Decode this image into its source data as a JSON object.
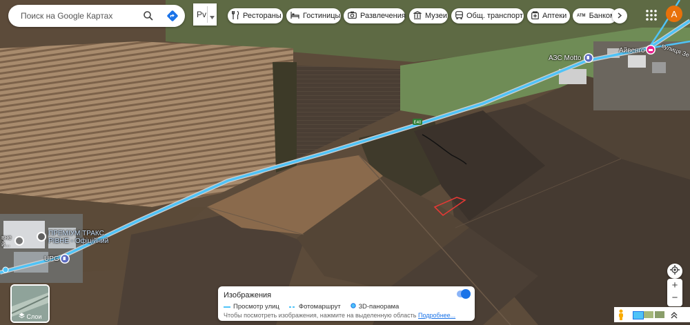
{
  "search": {
    "placeholder": "Поиск на Google Картах"
  },
  "language": {
    "value": "Рv"
  },
  "categories": [
    {
      "label": "Рестораны",
      "icon": "fork-knife-icon"
    },
    {
      "label": "Гостиницы",
      "icon": "bed-icon"
    },
    {
      "label": "Развлечения",
      "icon": "camera-icon"
    },
    {
      "label": "Музеи",
      "icon": "museum-icon"
    },
    {
      "label": "Общ. транспорт",
      "icon": "bus-icon"
    },
    {
      "label": "Аптеки",
      "icon": "pharmacy-icon"
    },
    {
      "label": "Банкоматы",
      "icon": "atm-icon",
      "icon_text": "ATM"
    }
  ],
  "account": {
    "initial": "А",
    "color": "#e8710a"
  },
  "map_labels": {
    "gas_station": "АЗС Motto",
    "aivengo": "Айвенго",
    "street": "вулиця Зе",
    "premium_line1": "ПРЕМІУМ ТРАКС",
    "premium_line2": "РІВНЕ - Офіційний",
    "upg": "UPG",
    "left_line1": "вне",
    "left_line2": "й...",
    "road_sign": "E40"
  },
  "layers": {
    "label": "Слои"
  },
  "imagery_panel": {
    "title": "Изображения",
    "legend": [
      {
        "label": "Просмотр улиц",
        "style": "solid"
      },
      {
        "label": "Фотомаршрут",
        "style": "dashed"
      },
      {
        "label": "3D-панорама",
        "style": "circle"
      }
    ],
    "hint": "Чтобы посмотреть изображения, нажмите на выделенную область",
    "more_link": "Подробнее..."
  },
  "colors": {
    "street_view": "#4fc3f7",
    "accent": "#1a73e8",
    "selection": "#e53935"
  }
}
